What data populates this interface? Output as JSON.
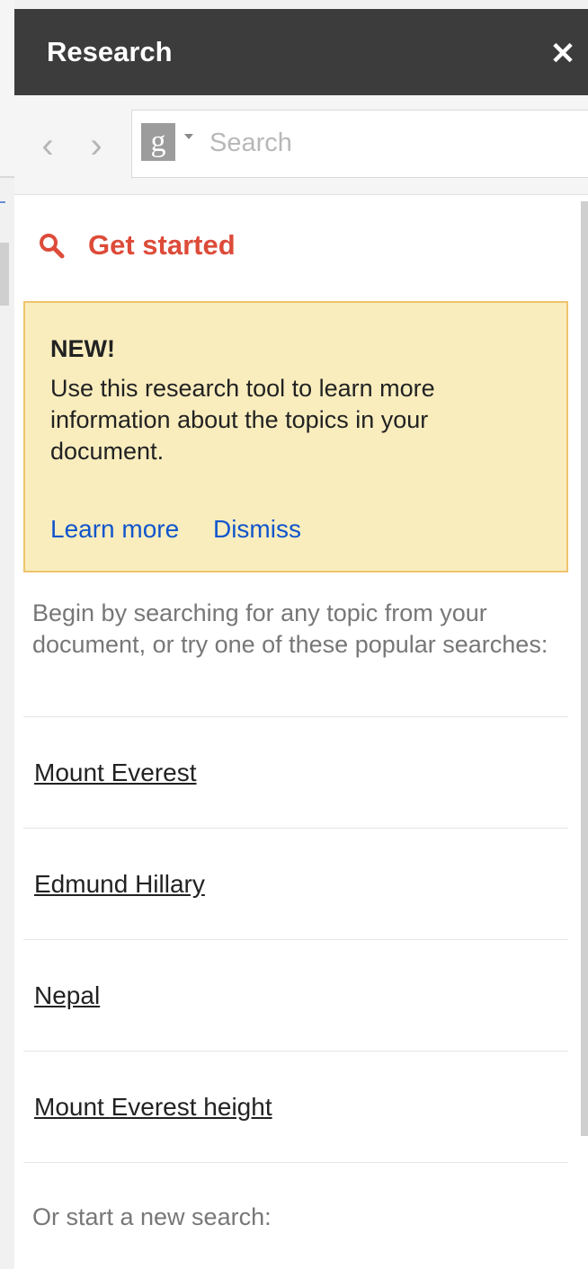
{
  "panel": {
    "title": "Research",
    "close_glyph": "✕"
  },
  "toolbar": {
    "back_glyph": "‹",
    "forward_glyph": "›",
    "engine_logo": "g",
    "search_placeholder": "Search",
    "search_value": ""
  },
  "get_started": {
    "label": "Get started"
  },
  "notice": {
    "title": "NEW!",
    "body": "Use this research tool to learn more information about the topics in your document.",
    "learn_more": "Learn more",
    "dismiss": "Dismiss"
  },
  "intro_text": "Begin by searching for any topic from your document, or try one of these popular searches:",
  "popular_searches": [
    "Mount Everest",
    "Edmund Hillary",
    "Nepal",
    "Mount Everest height"
  ],
  "new_search_text": "Or start a new search:",
  "colors": {
    "titlebar": "#3c3c3c",
    "accent_red": "#dd4b39",
    "link_blue": "#1155cc",
    "notice_bg": "#f9edbe",
    "notice_border": "#f0c36d"
  },
  "icons": {
    "close": "close-icon",
    "back": "chevron-left-icon",
    "forward": "chevron-right-icon",
    "engine": "google-plus-icon",
    "dropdown": "caret-down-icon",
    "search": "magnifier-icon"
  }
}
